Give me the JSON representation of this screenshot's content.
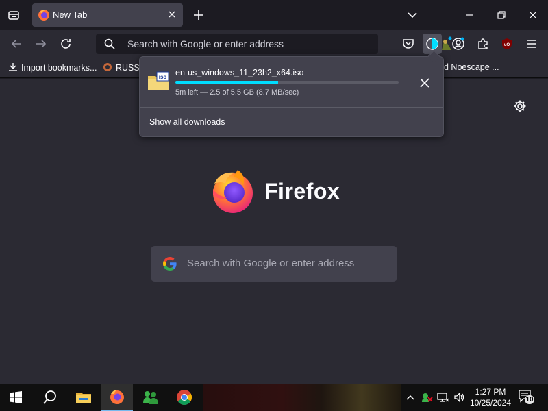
{
  "window": {
    "tab": {
      "title": "New Tab",
      "favicon": "firefox-icon",
      "close": "close-icon"
    },
    "controls": [
      "minimize-icon",
      "restore-icon",
      "close-icon"
    ]
  },
  "navbar": {
    "url_placeholder": "Search with Google or enter address",
    "icons": [
      "back-arrow-icon",
      "forward-arrow-icon",
      "reload-icon",
      "search-icon",
      "pocket-icon",
      "downloads-icon",
      "extension-icon",
      "account-icon",
      "extensions-icon",
      "ublock-icon",
      "menu-icon"
    ]
  },
  "bookmarks": {
    "import": "Import bookmarks...",
    "item1": "RUSSI",
    "item2": "d Noescape ..."
  },
  "downloads_panel": {
    "file_name": "en-us_windows_11_23h2_x64.iso",
    "file_icon_label": "iso",
    "progress": 0.46,
    "status": "5m left — 2.5 of 5.5 GB (8.7 MB/sec)",
    "show_all": "Show all downloads"
  },
  "newtab": {
    "brand": "Firefox",
    "search_placeholder": "Search with Google or enter address"
  },
  "colors": {
    "accent": "#00ddff",
    "tab_bg": "#42414d",
    "content_bg": "#2b2a33",
    "firefox_orange": "#ff7139",
    "firefox_purple": "#7542e5"
  },
  "taskbar": {
    "time": "1:27 PM",
    "date": "10/25/2024",
    "notification_count": "10",
    "apps": [
      "windows-start-icon",
      "search-icon",
      "file-explorer-icon",
      "firefox-icon",
      "messenger-icon",
      "chrome-icon"
    ]
  }
}
